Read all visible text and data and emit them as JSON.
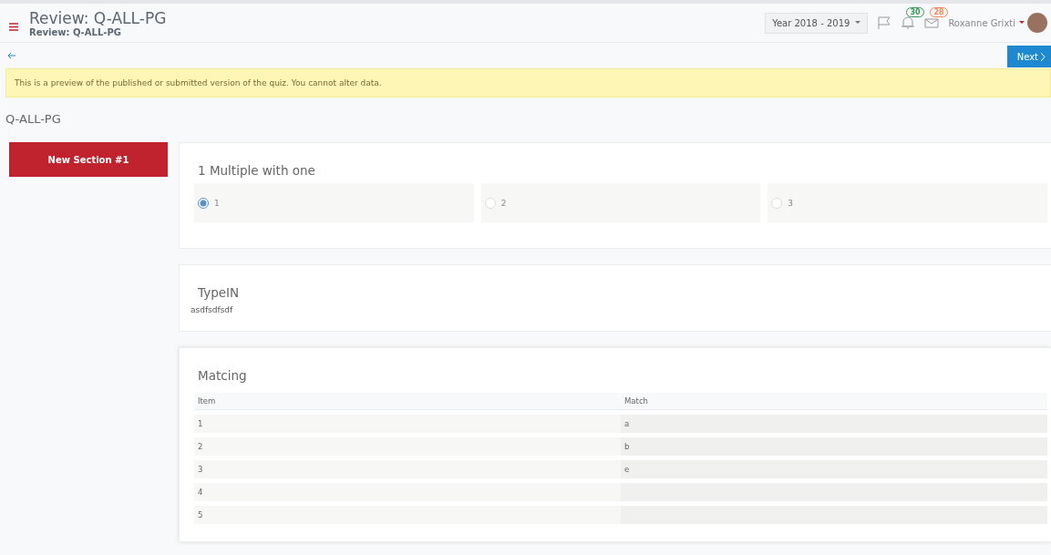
{
  "header": {
    "title": "Review: Q-ALL-PG",
    "subtitle": "Review: Q-ALL-PG",
    "year": "Year 2018 - 2019",
    "notifications": [
      {
        "kind": "flag"
      },
      {
        "kind": "bell",
        "count": "30",
        "color": "#3a9a5b"
      },
      {
        "kind": "mail",
        "count": "28",
        "color": "#f08a5d"
      }
    ],
    "user": "Roxanne Grixti"
  },
  "next_button": "Next",
  "notice": "This is a preview of the published or submitted version of the quiz. You cannot alter data.",
  "quiz_title": "Q-ALL-PG",
  "sections": [
    {
      "label": "New Section #1",
      "selected": true
    }
  ],
  "questions": [
    {
      "kind": "choice",
      "title": "1 Multiple with one",
      "options": [
        {
          "label": "1",
          "selected": true
        },
        {
          "label": "2",
          "selected": false
        },
        {
          "label": "3",
          "selected": false
        }
      ]
    },
    {
      "kind": "text",
      "title": "TypeIN",
      "answer": "asdfsdfsdf"
    },
    {
      "kind": "matching",
      "title": "Matcing",
      "columns": [
        "Item",
        "Match"
      ],
      "rows": [
        [
          "1",
          "a"
        ],
        [
          "2",
          "b"
        ],
        [
          "3",
          "e"
        ],
        [
          "4",
          ""
        ],
        [
          "5",
          ""
        ]
      ]
    }
  ]
}
